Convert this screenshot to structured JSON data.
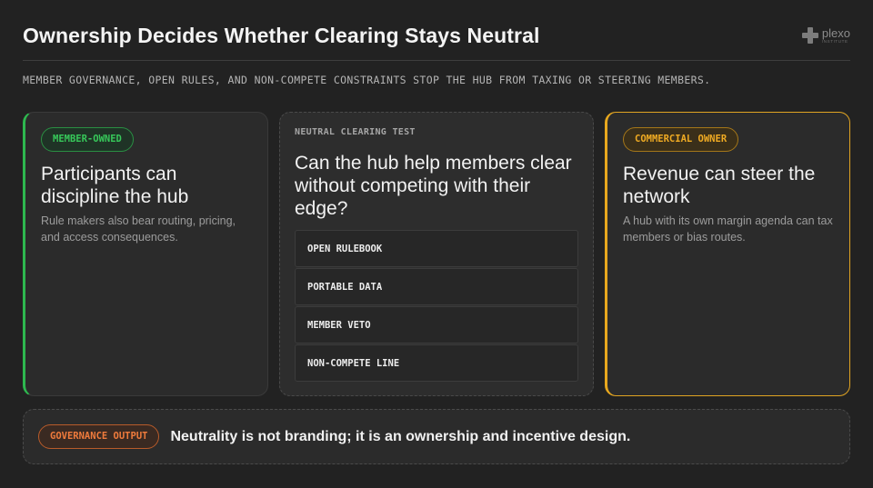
{
  "header": {
    "title": "Ownership Decides Whether Clearing Stays Neutral",
    "subtitle": "MEMBER GOVERNANCE, OPEN RULES, AND NON-COMPETE CONSTRAINTS STOP THE HUB FROM TAXING OR STEERING MEMBERS."
  },
  "logo": {
    "name": "plexo",
    "sub": "INSTITUTE"
  },
  "colors": {
    "background": "#222222",
    "member_green": "#2eb84f",
    "commercial_amber": "#e8a81e",
    "governance_orange": "#ef7b3c"
  },
  "member_card": {
    "badge": "MEMBER-OWNED",
    "heading": "Participants can discipline the hub",
    "body": "Rule makers also bear routing, pricing, and access consequences."
  },
  "test_card": {
    "label": "NEUTRAL CLEARING TEST",
    "question": "Can the hub help members clear without competing with their edge?",
    "criteria": [
      "OPEN RULEBOOK",
      "PORTABLE DATA",
      "MEMBER VETO",
      "NON-COMPETE LINE"
    ]
  },
  "commercial_card": {
    "badge": "COMMERCIAL OWNER",
    "heading": "Revenue can steer the network",
    "body": "A hub with its own margin agenda can tax members or bias routes."
  },
  "output": {
    "badge": "GOVERNANCE OUTPUT",
    "text": "Neutrality is not branding; it is an ownership and incentive design."
  }
}
